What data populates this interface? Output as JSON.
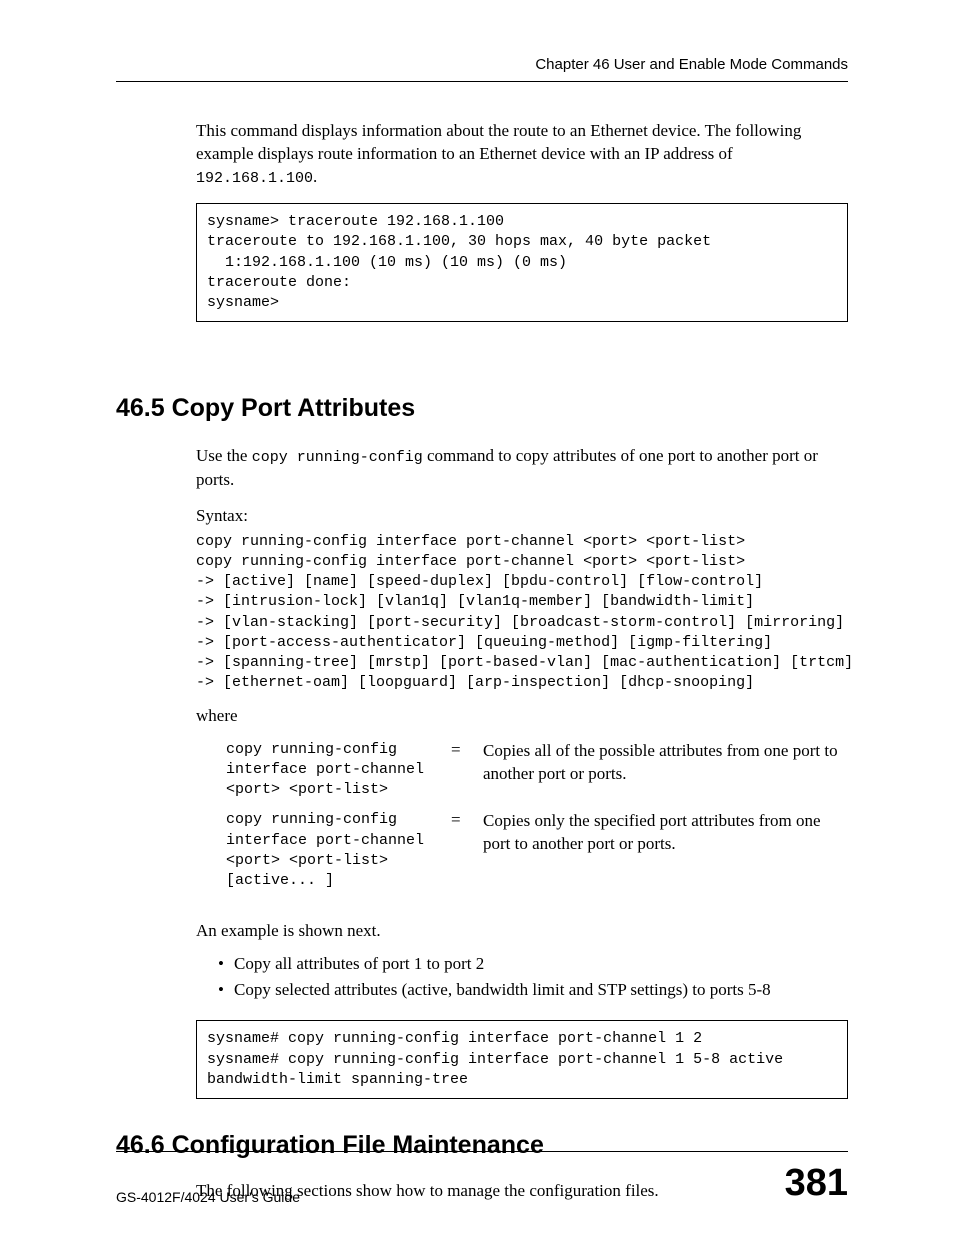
{
  "header": {
    "chapter": "Chapter 46 User and Enable Mode Commands"
  },
  "intro": {
    "para1": "This command displays information about the route to an Ethernet device. The following example displays route information to an Ethernet device with an IP address of ",
    "ip": "192.168.1.100",
    "period": "."
  },
  "codebox1": "sysname> traceroute 192.168.1.100\ntraceroute to 192.168.1.100, 30 hops max, 40 byte packet\n  1:192.168.1.100 (10 ms) (10 ms) (0 ms)\ntraceroute done:\nsysname>",
  "section465": {
    "heading": "46.5  Copy Port Attributes",
    "para_pre": "Use the ",
    "para_code": "copy running-config",
    "para_post": " command to copy attributes of one port to another port or ports.",
    "syntax_label": "Syntax:",
    "syntax_block": "copy running-config interface port-channel <port> <port-list>\ncopy running-config interface port-channel <port> <port-list>\n-> [active] [name] [speed-duplex] [bpdu-control] [flow-control]\n-> [intrusion-lock] [vlan1q] [vlan1q-member] [bandwidth-limit]\n-> [vlan-stacking] [port-security] [broadcast-storm-control] [mirroring]\n-> [port-access-authenticator] [queuing-method] [igmp-filtering]\n-> [spanning-tree] [mrstp] [port-based-vlan] [mac-authentication] [trtcm]\n-> [ethernet-oam] [loopguard] [arp-inspection] [dhcp-snooping]",
    "where_label": "where",
    "defs": [
      {
        "code": "copy running-config interface port-channel <port> <port-list>",
        "eq": "=",
        "desc": "Copies all of the possible attributes from one port to another port or ports."
      },
      {
        "code": "copy running-config interface port-channel <port> <port-list>  [active... ]",
        "eq": "=",
        "desc": "Copies only the specified port attributes from one port to another port or ports."
      }
    ],
    "example_intro": "An example is shown next.",
    "bullets": [
      "Copy all attributes of port 1 to port 2",
      "Copy selected attributes (active, bandwidth limit and STP settings) to ports 5-8"
    ],
    "codebox2": "sysname# copy running-config interface port-channel 1 2\nsysname# copy running-config interface port-channel 1 5-8 active \nbandwidth-limit spanning-tree"
  },
  "section466": {
    "heading": "46.6  Configuration File Maintenance",
    "para": "The following sections show how to manage the configuration files."
  },
  "footer": {
    "guide": "GS-4012F/4024 User's Guide",
    "page": "381"
  }
}
